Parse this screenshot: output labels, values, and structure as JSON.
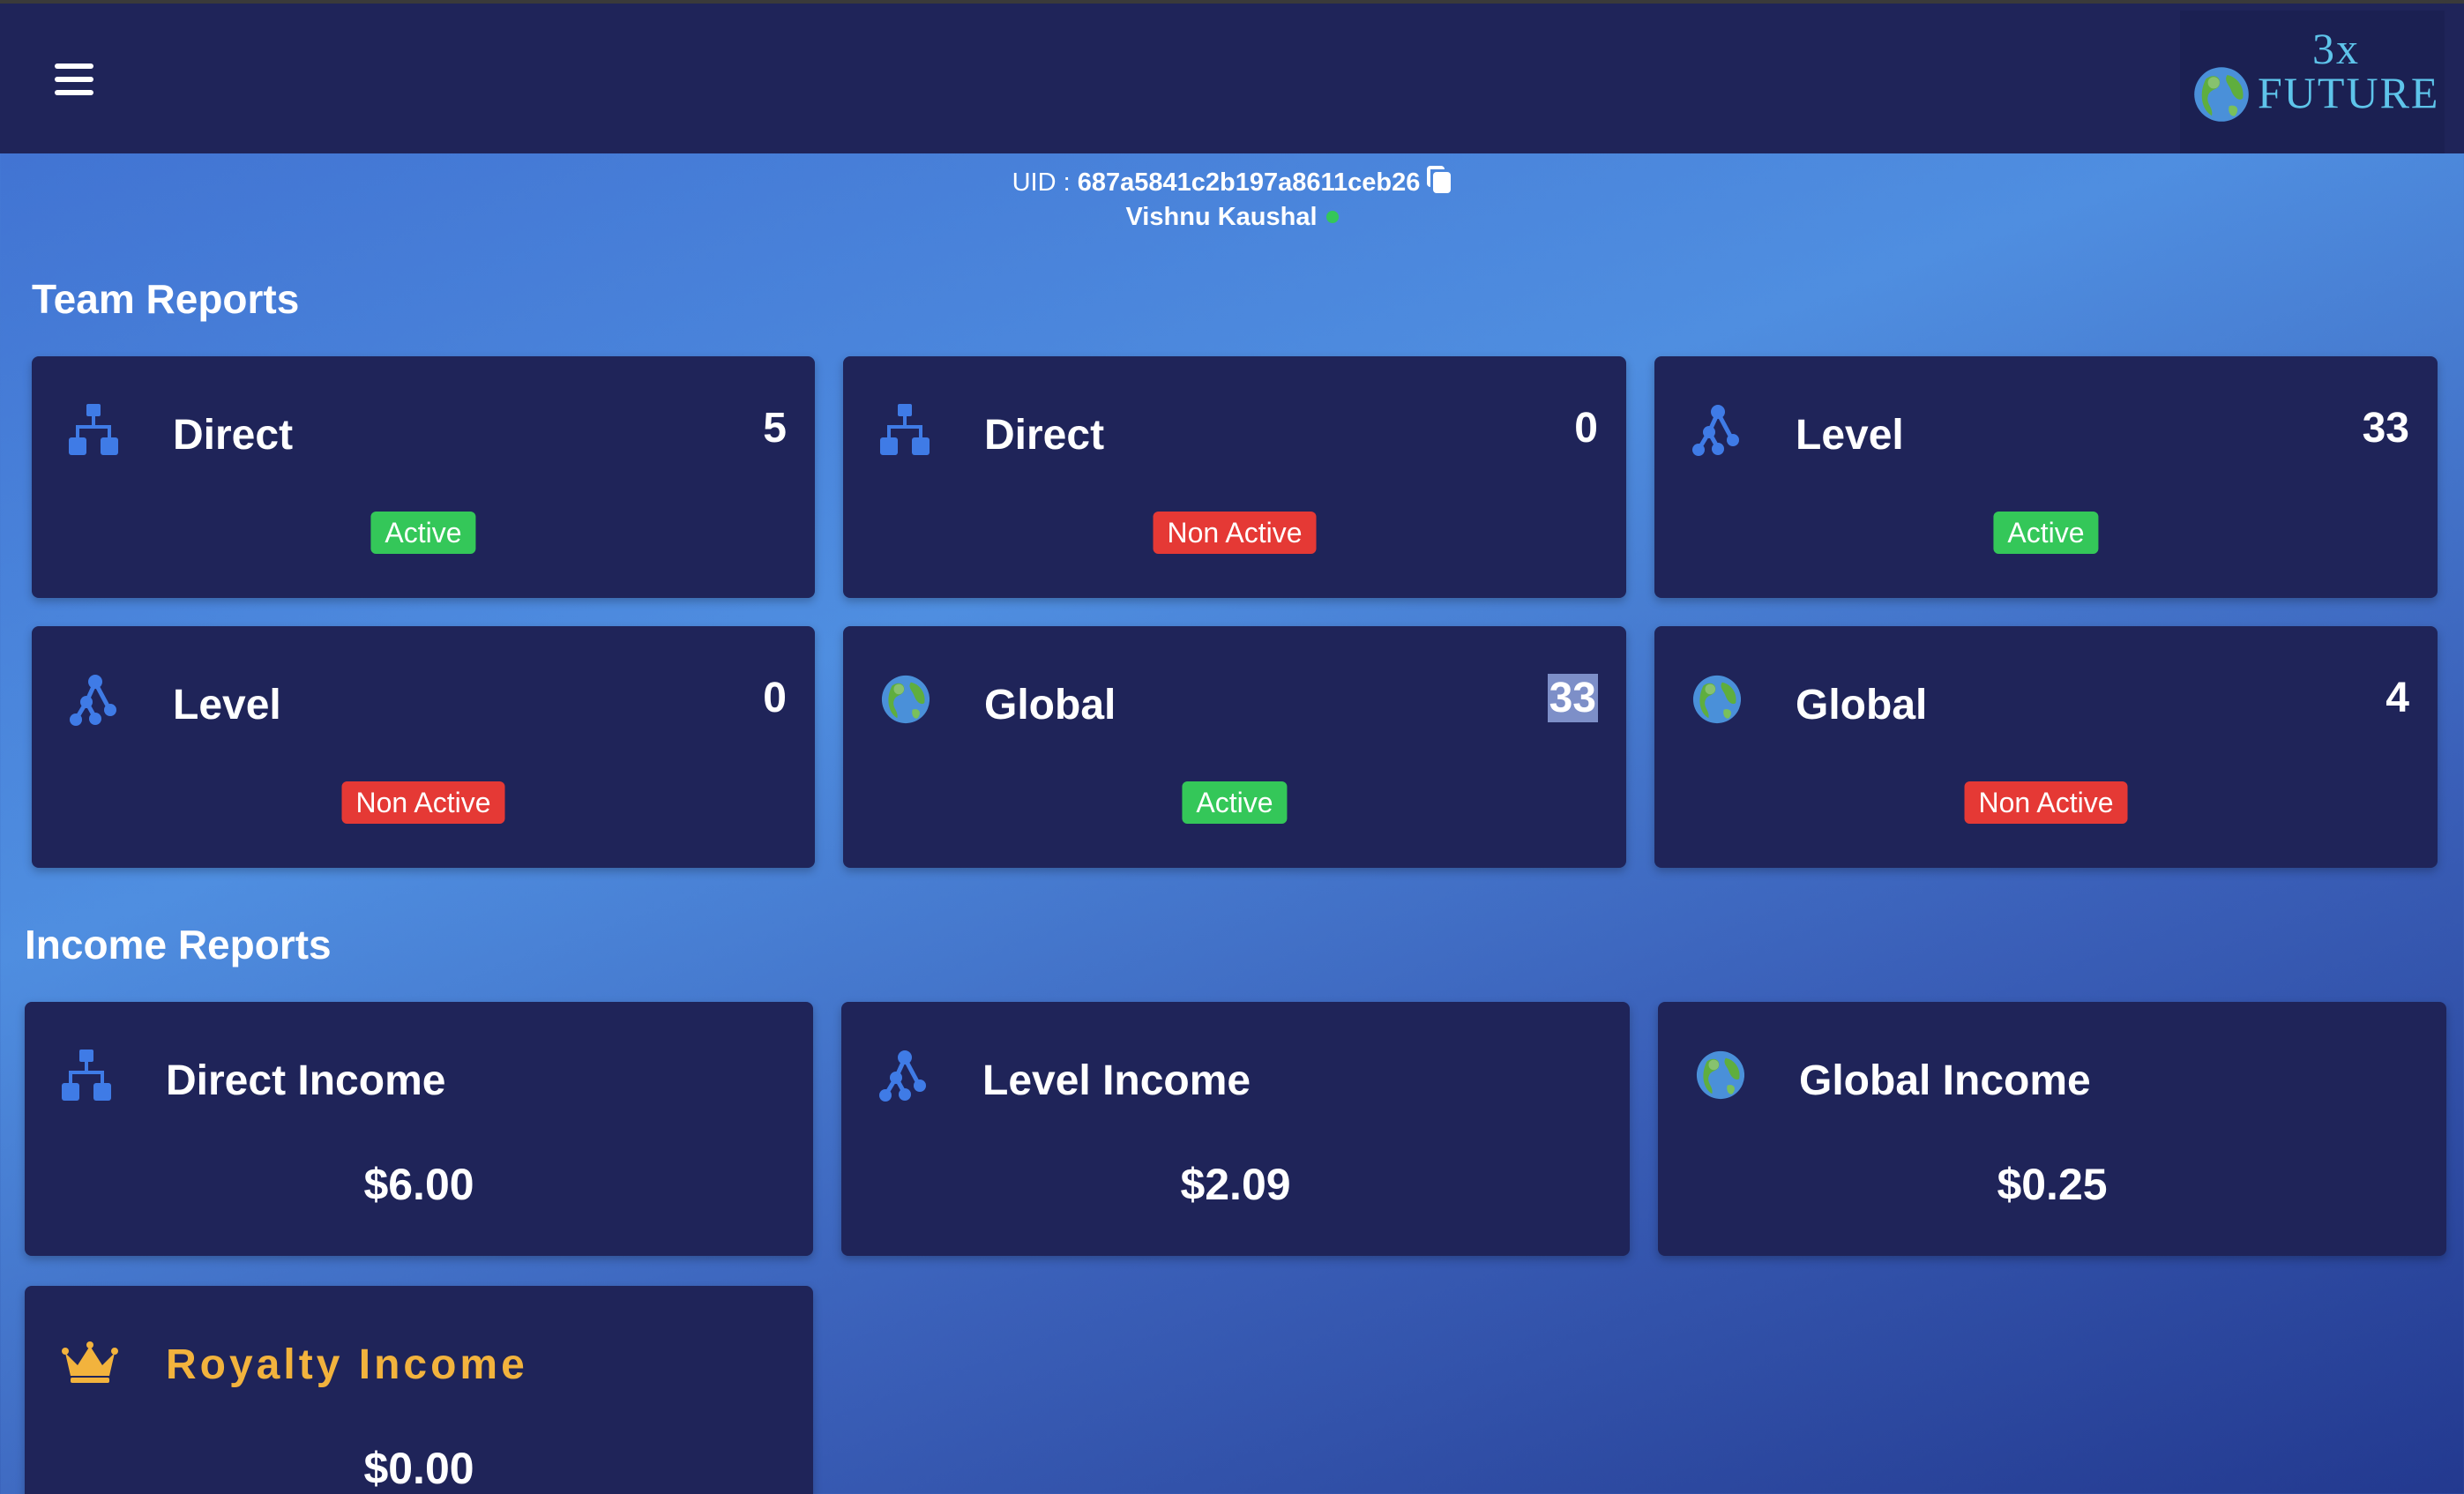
{
  "header": {
    "logo_line1": "3x",
    "logo_line2": "FUTURE"
  },
  "user": {
    "uid_label": "UID : ",
    "uid": "687a5841c2b197a8611ceb26",
    "name": "Vishnu Kaushal",
    "online_color": "#34c759"
  },
  "team_reports": {
    "title": "Team Reports",
    "cards": [
      {
        "icon": "sitemap-icon",
        "title": "Direct",
        "count": "5",
        "status": "Active"
      },
      {
        "icon": "sitemap-icon",
        "title": "Direct",
        "count": "0",
        "status": "Non Active"
      },
      {
        "icon": "network-tree-icon",
        "title": "Level",
        "count": "33",
        "status": "Active"
      },
      {
        "icon": "network-tree-icon",
        "title": "Level",
        "count": "0",
        "status": "Non Active"
      },
      {
        "icon": "globe-icon",
        "title": "Global",
        "count": "33",
        "status": "Active"
      },
      {
        "icon": "globe-icon",
        "title": "Global",
        "count": "4",
        "status": "Non Active"
      }
    ]
  },
  "income_reports": {
    "title": "Income Reports",
    "cards": [
      {
        "icon": "sitemap-icon",
        "title": "Direct Income",
        "amount": "$6.00"
      },
      {
        "icon": "network-tree-icon",
        "title": "Level Income",
        "amount": "$2.09"
      },
      {
        "icon": "globe-icon",
        "title": "Global Income",
        "amount": "$0.25"
      },
      {
        "icon": "crown-icon",
        "title": "Royalty Income",
        "amount": "$0.00"
      }
    ]
  },
  "colors": {
    "card_bg": "#1f2459",
    "active": "#34c759",
    "inactive": "#e53935",
    "icon_blue": "#3f7be6",
    "royalty_gold": "#f2b33d",
    "logo_cyan": "#5ec4ea"
  }
}
